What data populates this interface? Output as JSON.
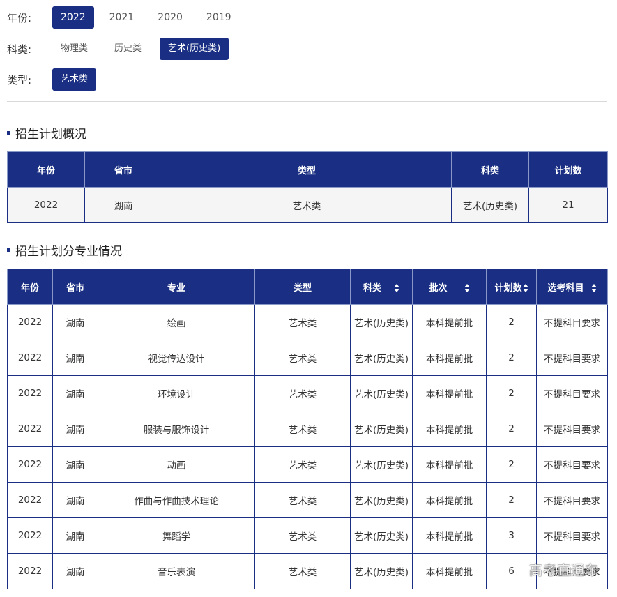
{
  "filters": {
    "year": {
      "label": "年份:",
      "options": [
        "2022",
        "2021",
        "2020",
        "2019"
      ],
      "selected": "2022"
    },
    "subject": {
      "label": "科类:",
      "options": [
        "物理类",
        "历史类",
        "艺术(历史类)"
      ],
      "selected": "艺术(历史类)"
    },
    "type": {
      "label": "类型:",
      "options": [
        "艺术类"
      ],
      "selected": "艺术类"
    }
  },
  "overview": {
    "title": "招生计划概况",
    "headers": [
      "年份",
      "省市",
      "类型",
      "科类",
      "计划数"
    ],
    "row": [
      "2022",
      "湖南",
      "艺术类",
      "艺术(历史类)",
      "21"
    ]
  },
  "majors": {
    "title": "招生计划分专业情况",
    "headers": [
      "年份",
      "省市",
      "专业",
      "类型",
      "科类",
      "批次",
      "计划数",
      "选考科目"
    ],
    "rows": [
      [
        "2022",
        "湖南",
        "绘画",
        "艺术类",
        "艺术(历史类)",
        "本科提前批",
        "2",
        "不提科目要求"
      ],
      [
        "2022",
        "湖南",
        "视觉传达设计",
        "艺术类",
        "艺术(历史类)",
        "本科提前批",
        "2",
        "不提科目要求"
      ],
      [
        "2022",
        "湖南",
        "环境设计",
        "艺术类",
        "艺术(历史类)",
        "本科提前批",
        "2",
        "不提科目要求"
      ],
      [
        "2022",
        "湖南",
        "服装与服饰设计",
        "艺术类",
        "艺术(历史类)",
        "本科提前批",
        "2",
        "不提科目要求"
      ],
      [
        "2022",
        "湖南",
        "动画",
        "艺术类",
        "艺术(历史类)",
        "本科提前批",
        "2",
        "不提科目要求"
      ],
      [
        "2022",
        "湖南",
        "作曲与作曲技术理论",
        "艺术类",
        "艺术(历史类)",
        "本科提前批",
        "2",
        "不提科目要求"
      ],
      [
        "2022",
        "湖南",
        "舞蹈学",
        "艺术类",
        "艺术(历史类)",
        "本科提前批",
        "3",
        "不提科目要求"
      ],
      [
        "2022",
        "湖南",
        "音乐表演",
        "艺术类",
        "艺术(历史类)",
        "本科提前批",
        "6",
        "不提科目要求"
      ]
    ]
  },
  "watermark": "高考直通车",
  "colors": {
    "accent": "#1a2f83"
  }
}
